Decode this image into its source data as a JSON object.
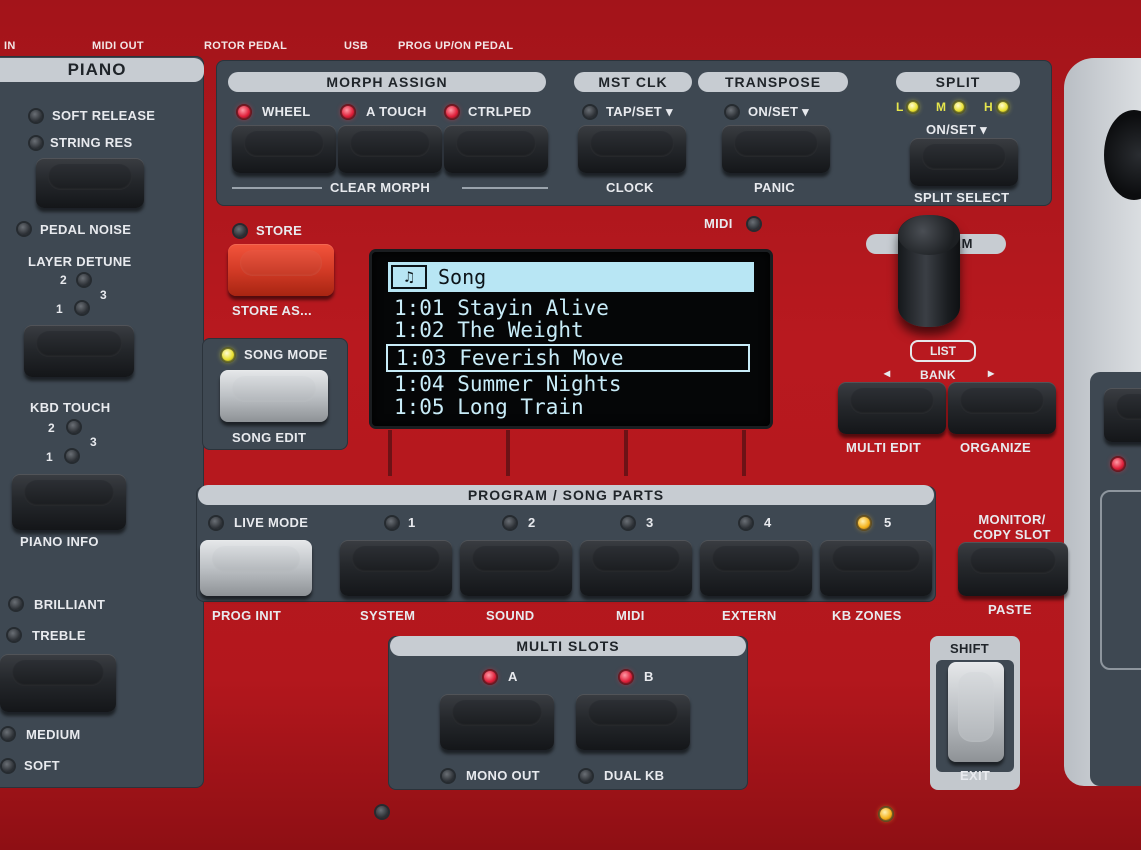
{
  "top_labels": [
    "IN",
    "MIDI OUT",
    "ROTOR PEDAL",
    "USB",
    "PROG UP/ON PEDAL"
  ],
  "piano": {
    "title": "PIANO",
    "soft_release": "SOFT RELEASE",
    "string_res": "STRING RES",
    "pedal_noise": "PEDAL NOISE",
    "layer_detune": "LAYER DETUNE",
    "kbd_touch": "KBD TOUCH",
    "piano_info": "PIANO INFO",
    "brilliant": "BRILLIANT",
    "treble": "TREBLE",
    "medium": "MEDIUM",
    "soft": "SOFT",
    "num1": "1",
    "num2": "2",
    "num3": "3"
  },
  "morph": {
    "title": "MORPH ASSIGN",
    "wheel": "WHEEL",
    "a_touch": "A TOUCH",
    "ctrlped": "CTRLPED",
    "clear": "CLEAR MORPH"
  },
  "mst_clk": {
    "title": "MST CLK",
    "tap": "TAP/SET ▾",
    "clock": "CLOCK"
  },
  "transpose": {
    "title": "TRANSPOSE",
    "onset": "ON/SET ▾",
    "panic": "PANIC"
  },
  "split": {
    "title": "SPLIT",
    "l": "L",
    "m": "M",
    "h": "H",
    "onset": "ON/SET ▾",
    "select": "SPLIT SELECT"
  },
  "store": {
    "label": "STORE",
    "sub": "STORE AS..."
  },
  "midi_led": "MIDI",
  "song_mode": {
    "label": "SONG MODE",
    "sub": "SONG EDIT"
  },
  "display": {
    "icon": "♫",
    "title": "Song",
    "rows": [
      "1:01 Stayin Alive",
      "1:02 The Weight",
      "1:03 Feverish Move",
      "1:04 Summer Nights",
      "1:05 Long Train"
    ],
    "selected_index": 2
  },
  "program": {
    "title": "PROGRAM",
    "list": "LIST",
    "bank": "BANK",
    "left": "◂",
    "right": "▸",
    "multi_edit": "MULTI EDIT",
    "organize": "ORGANIZE"
  },
  "parts": {
    "title": "PROGRAM / SONG PARTS",
    "live_mode": "LIVE MODE",
    "prog_init": "PROG INIT",
    "slots": [
      {
        "num": "1",
        "label": "SYSTEM"
      },
      {
        "num": "2",
        "label": "SOUND"
      },
      {
        "num": "3",
        "label": "MIDI"
      },
      {
        "num": "4",
        "label": "EXTERN"
      },
      {
        "num": "5",
        "label": "KB ZONES"
      }
    ]
  },
  "monitor": {
    "label": "MONITOR/ COPY SLOT",
    "sub": "PASTE"
  },
  "multi_slots": {
    "title": "MULTI SLOTS",
    "a": "A",
    "b": "B",
    "mono_out": "MONO OUT",
    "dual_kb": "DUAL KB"
  },
  "shift": {
    "label": "SHIFT",
    "sub": "EXIT"
  }
}
